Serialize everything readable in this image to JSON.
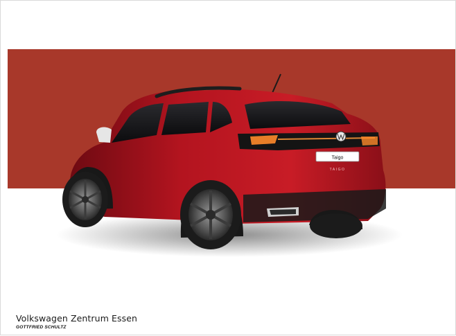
{
  "vehicle": {
    "model_badge": "Taigo",
    "model_lettering": "TAIGO",
    "body_color": "#b3141f",
    "background_band_color": "#a8382a"
  },
  "dealer": {
    "name": "Volkswagen Zentrum Essen",
    "subtitle": "GOTTFRIED SCHULTZ"
  }
}
